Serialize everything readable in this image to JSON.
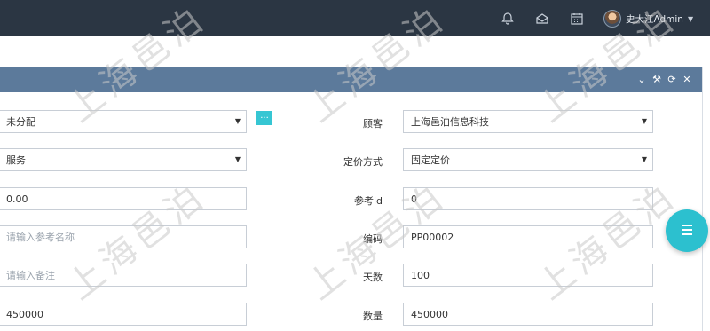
{
  "topbar": {
    "icons": [
      "bell-icon",
      "envelope-icon",
      "calendar-icon"
    ],
    "user_name": "史大江Admin"
  },
  "panel": {
    "tools": [
      "chevron-down-icon",
      "wrench-icon",
      "refresh-icon",
      "close-icon"
    ]
  },
  "form": {
    "assign_value": "未分配",
    "type_value": "服务",
    "price_value": "0.00",
    "ref_name_placeholder": "请输入参考名称",
    "note_placeholder": "请输入备注",
    "left_bottom_value": "450000",
    "customer_label": "顾客",
    "customer_value": "上海邑泊信息科技",
    "pricing_label": "定价方式",
    "pricing_value": "固定定价",
    "ref_id_label": "参考id",
    "ref_id_value": "0",
    "code_label": "编码",
    "code_value": "PP00002",
    "days_label": "天数",
    "days_value": "100",
    "qty_label": "数量",
    "qty_value": "450000",
    "more_button_label": "..."
  },
  "watermark": "上海邑泊",
  "colors": {
    "topbar_bg": "#2b3643",
    "panel_header_bg": "#5c7a9b",
    "accent": "#36c6d3",
    "fab": "#2cc0cf"
  }
}
